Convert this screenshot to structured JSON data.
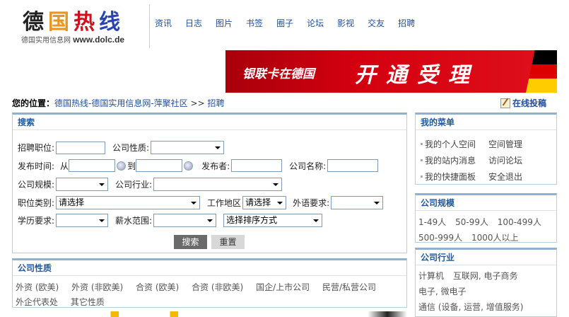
{
  "logo": {
    "chars": [
      "德",
      "国",
      "热",
      "线"
    ],
    "sub_cn": "德国实用信息网",
    "sub_url": "www.dolc.de"
  },
  "nav": [
    "资讯",
    "日志",
    "图片",
    "书签",
    "圈子",
    "论坛",
    "影视",
    "交友",
    "招聘"
  ],
  "banner": {
    "left_text": "银联卡在德国",
    "right_text": "开通受理",
    "flag_colors": [
      "#000000",
      "#dd0000",
      "#ffcc00"
    ]
  },
  "breadcrumb": {
    "prefix": "您的位置：",
    "site": "德国热线-德国实用信息网-萍聚社区",
    "sep": ">>",
    "current": "招聘"
  },
  "post_button": "在线投稿",
  "search": {
    "title": "搜索",
    "job_position": "招聘职位:",
    "company_type": "公司性质:",
    "publish_time": "发布时间:",
    "from": "从",
    "to": "到",
    "publisher": "发布者:",
    "company_name": "公司名称:",
    "company_scale": "公司规模:",
    "company_industry": "公司行业:",
    "job_category": "职位类别:",
    "job_category_value": "请选择",
    "work_area": "工作地区",
    "work_area_value": "请选择",
    "language_req": "外语要求:",
    "education_req": "学历要求:",
    "salary_range": "薪水范围:",
    "sort_value": "选择排序方式",
    "search_button": "搜索",
    "reset_button": "重置"
  },
  "company_nature": {
    "title": "公司性质",
    "row1": [
      "外资 (欧美)",
      "外资 (非欧美)",
      "合资 (欧美)",
      "合资 (非欧美)",
      "国企/上市公司",
      "民营/私营公司"
    ],
    "row2": [
      "外企代表处",
      "其它性质"
    ]
  },
  "my_menu": {
    "title": "我的菜单",
    "items": [
      [
        "我的个人空间",
        "空间管理"
      ],
      [
        "我的站内消息",
        "访问论坛"
      ],
      [
        "我的快捷面板",
        "安全退出"
      ]
    ]
  },
  "company_scale": {
    "title": "公司规模",
    "row1": [
      "1-49人",
      "50-99人",
      "100-499人"
    ],
    "row2": [
      "500-999人",
      "1000人以上"
    ]
  },
  "company_industry": {
    "title": "公司行业",
    "row1": [
      "计算机",
      "互联网, 电子商务"
    ],
    "row2": [
      "电子, 微电子"
    ],
    "row3": [
      "通信 (设备, 运营, 增值服务)"
    ]
  }
}
